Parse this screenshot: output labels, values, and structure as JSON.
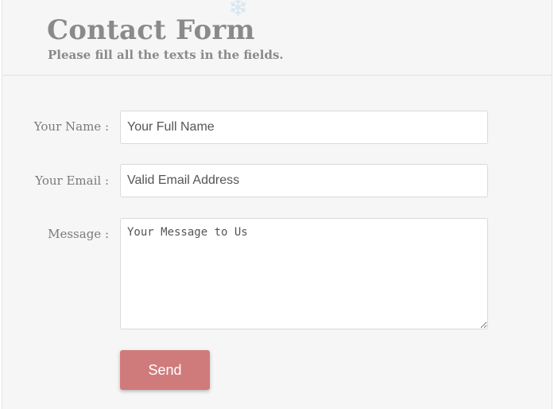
{
  "header": {
    "title": "Contact Form",
    "subtitle": "Please fill all the texts in the fields.",
    "decoration_icon": "snowflake-icon"
  },
  "form": {
    "name": {
      "label": "Your Name :",
      "placeholder": "Your Full Name"
    },
    "email": {
      "label": "Your Email :",
      "placeholder": "Valid Email Address"
    },
    "message": {
      "label": "Message :",
      "placeholder": "Your Message to Us"
    },
    "send_label": "Send"
  },
  "colors": {
    "background": "#f6f6f6",
    "heading": "#8a8a8a",
    "send_button": "#cf7b7b"
  }
}
